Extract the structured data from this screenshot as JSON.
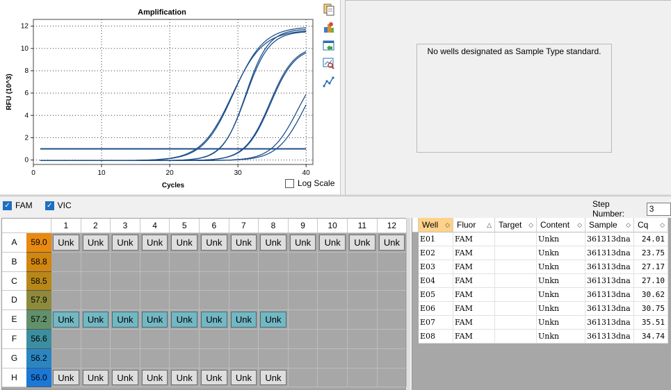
{
  "chart": {
    "title": "Amplification",
    "xlabel": "Cycles",
    "ylabel": "RFU (10^3)",
    "log_scale_label": "Log Scale"
  },
  "toolbar_icons": [
    "copy-icon",
    "export-icon",
    "save-image-icon",
    "zoom-icon",
    "plot-settings-icon"
  ],
  "chart_data": {
    "type": "line",
    "title": "Amplification",
    "xlabel": "Cycles",
    "ylabel": "RFU (10^3)",
    "xlim": [
      0,
      41
    ],
    "ylim": [
      -0.4,
      12.6
    ],
    "xticks": [
      0,
      10,
      20,
      30,
      40
    ],
    "yticks": [
      0,
      2,
      4,
      6,
      8,
      10,
      12
    ],
    "grid": true,
    "threshold": 1.0,
    "series": [
      {
        "cq": 24.01,
        "max": 12.0,
        "k": 0.45,
        "color": "#1d4f8c"
      },
      {
        "cq": 23.75,
        "max": 11.7,
        "k": 0.44,
        "color": "#1d4f8c"
      },
      {
        "cq": 27.17,
        "max": 11.8,
        "k": 0.6,
        "color": "#1d4f8c"
      },
      {
        "cq": 27.1,
        "max": 11.6,
        "k": 0.58,
        "color": "#1d4f8c"
      },
      {
        "cq": 30.62,
        "max": 10.3,
        "k": 0.55,
        "color": "#1d4f8c"
      },
      {
        "cq": 30.75,
        "max": 10.2,
        "k": 0.55,
        "color": "#1d4f8c"
      },
      {
        "cq": 35.51,
        "max": 9.5,
        "k": 0.5,
        "color": "#1d4f8c"
      },
      {
        "cq": 34.74,
        "max": 9.0,
        "k": 0.52,
        "color": "#1d4f8c"
      }
    ]
  },
  "std_message": "No wells designated as Sample Type standard.",
  "fluors": [
    {
      "label": "FAM",
      "checked": true
    },
    {
      "label": "VIC",
      "checked": true
    }
  ],
  "step": {
    "label": "Step Number:",
    "value": "3"
  },
  "plate": {
    "columns": [
      "1",
      "2",
      "3",
      "4",
      "5",
      "6",
      "7",
      "8",
      "9",
      "10",
      "11",
      "12"
    ],
    "rows": [
      {
        "label": "A",
        "temp": "59.0",
        "color": "#e88a10",
        "wells": 12,
        "selected": false
      },
      {
        "label": "B",
        "temp": "58.8",
        "color": "#d0860f",
        "wells": 0,
        "selected": false
      },
      {
        "label": "C",
        "temp": "58.5",
        "color": "#b98718",
        "wells": 0,
        "selected": false
      },
      {
        "label": "D",
        "temp": "57.9",
        "color": "#8e8a3c",
        "wells": 0,
        "selected": false
      },
      {
        "label": "E",
        "temp": "57.2",
        "color": "#62906a",
        "wells": 8,
        "selected": true
      },
      {
        "label": "F",
        "temp": "56.6",
        "color": "#3d8ea0",
        "wells": 0,
        "selected": false
      },
      {
        "label": "G",
        "temp": "56.2",
        "color": "#2a86c2",
        "wells": 0,
        "selected": false
      },
      {
        "label": "H",
        "temp": "56.0",
        "color": "#1a78d8",
        "wells": 8,
        "selected": false
      }
    ],
    "well_label": "Unk"
  },
  "table": {
    "headers": [
      "Well",
      "Fluor",
      "Target",
      "Content",
      "Sample",
      "Cq"
    ],
    "rows": [
      [
        "E01",
        "FAM",
        "",
        "Unkn",
        "361313dna",
        "24.01"
      ],
      [
        "E02",
        "FAM",
        "",
        "Unkn",
        "361313dna",
        "23.75"
      ],
      [
        "E03",
        "FAM",
        "",
        "Unkn",
        "361313dna",
        "27.17"
      ],
      [
        "E04",
        "FAM",
        "",
        "Unkn",
        "361313dna",
        "27.10"
      ],
      [
        "E05",
        "FAM",
        "",
        "Unkn",
        "361313dna",
        "30.62"
      ],
      [
        "E06",
        "FAM",
        "",
        "Unkn",
        "361313dna",
        "30.75"
      ],
      [
        "E07",
        "FAM",
        "",
        "Unkn",
        "361313dna",
        "35.51"
      ],
      [
        "E08",
        "FAM",
        "",
        "Unkn",
        "361313dna",
        "34.74"
      ]
    ]
  }
}
